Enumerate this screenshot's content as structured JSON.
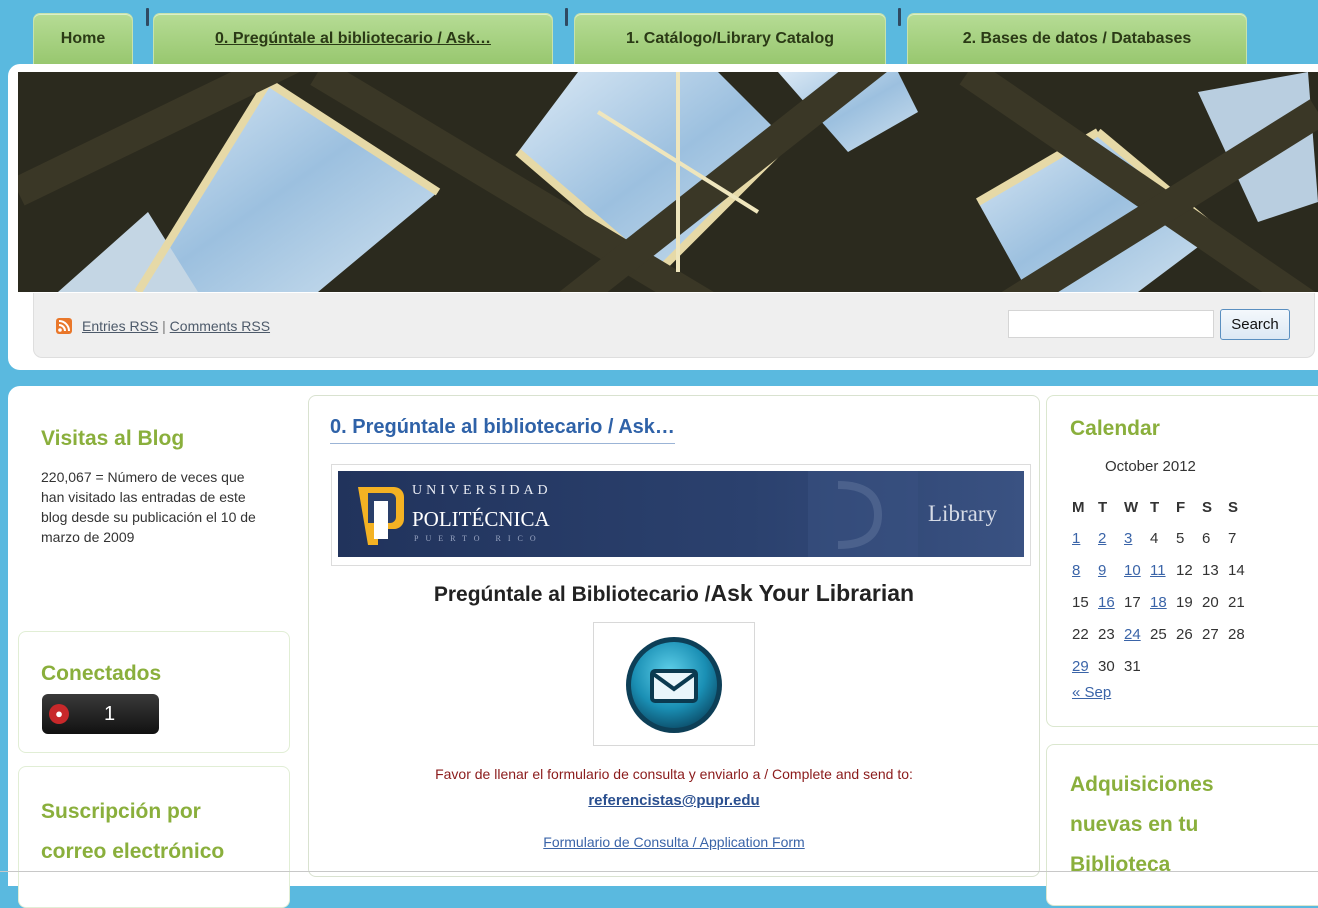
{
  "nav": {
    "tabs": [
      {
        "label": "Home",
        "active": false
      },
      {
        "label": "0. Pregúntale al bibliotecario / Ask…",
        "active": true
      },
      {
        "label": "1. Catálogo/Library Catalog",
        "active": false
      },
      {
        "label": "2. Bases de datos / Databases",
        "active": false
      }
    ]
  },
  "header": {
    "rss_entries": "Entries RSS",
    "rss_separator": "|",
    "rss_comments": "Comments RSS",
    "search_value": "",
    "search_button": "Search"
  },
  "left_sidebar": {
    "visits": {
      "title": "Visitas al Blog",
      "text": "220,067 = Número de veces que han visitado las entradas de este blog desde su publicación el 10 de marzo de 2009"
    },
    "online": {
      "title": "Conectados",
      "count": "1"
    },
    "subscribe": {
      "title": "Suscripción por correo electrónico"
    }
  },
  "post": {
    "title": "0. Pregúntale al bibliotecario / Ask…",
    "logo": {
      "line1": "UNIVERSIDAD",
      "line2": "POLITÉCNICA",
      "line3": "PUERTO RICO",
      "library": "Library"
    },
    "heading_part1": "Pregúntale al Bibliotecario /",
    "heading_part2": "Ask Your Librarian",
    "consult_text": "Favor de llenar el formulario de consulta y enviarlo a / Complete and send to:",
    "email": "referencistas@pupr.edu",
    "form_link": "Formulario de Consulta / Application Form"
  },
  "calendar": {
    "title": "Calendar",
    "caption": "October 2012",
    "weekdays": [
      "M",
      "T",
      "W",
      "T",
      "F",
      "S",
      "S"
    ],
    "weeks": [
      [
        [
          "1",
          true
        ],
        [
          "2",
          true
        ],
        [
          "3",
          true
        ],
        [
          "4",
          false
        ],
        [
          "5",
          false
        ],
        [
          "6",
          false
        ],
        [
          "7",
          false
        ]
      ],
      [
        [
          "8",
          true
        ],
        [
          "9",
          true
        ],
        [
          "10",
          true
        ],
        [
          "11",
          true
        ],
        [
          "12",
          false
        ],
        [
          "13",
          false
        ],
        [
          "14",
          false
        ]
      ],
      [
        [
          "15",
          false
        ],
        [
          "16",
          true
        ],
        [
          "17",
          false
        ],
        [
          "18",
          true
        ],
        [
          "19",
          false
        ],
        [
          "20",
          false
        ],
        [
          "21",
          false
        ]
      ],
      [
        [
          "22",
          false
        ],
        [
          "23",
          false
        ],
        [
          "24",
          true
        ],
        [
          "25",
          false
        ],
        [
          "26",
          false
        ],
        [
          "27",
          false
        ],
        [
          "28",
          false
        ]
      ],
      [
        [
          "29",
          true
        ],
        [
          "30",
          false
        ],
        [
          "31",
          false
        ]
      ]
    ],
    "prev": "« Sep"
  },
  "acquisitions": {
    "title": "Adquisiciones nuevas en tu Biblioteca"
  },
  "colors": {
    "page_bg": "#5ab9df",
    "tab_green": "#a8d383",
    "widget_title_green": "#8aaf3c",
    "post_title_blue": "#2f62a8",
    "consult_text_red": "#8b1b1b"
  }
}
